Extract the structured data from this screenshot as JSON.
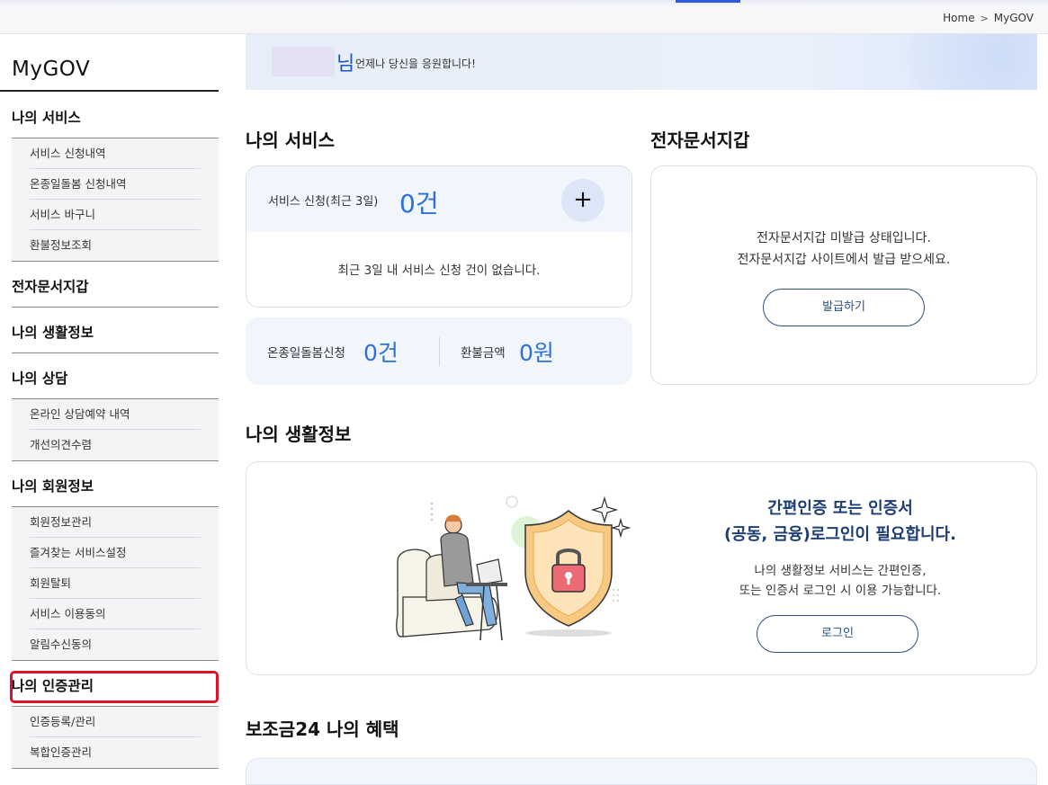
{
  "breadcrumb": {
    "home": "Home",
    "current": "MyGOV"
  },
  "sidebar": {
    "title": "MyGOV",
    "sections": [
      {
        "label": "나의 서비스",
        "items": [
          "서비스 신청내역",
          "온종일돌봄 신청내역",
          "서비스 바구니",
          "환불정보조회"
        ]
      },
      {
        "label": "전자문서지갑",
        "items": []
      },
      {
        "label": "나의 생활정보",
        "items": []
      },
      {
        "label": "나의 상담",
        "items": [
          "온라인 상담예약 내역",
          "개선의견수렴"
        ]
      },
      {
        "label": "나의 회원정보",
        "items": [
          "회원정보관리",
          "즐겨찾는 서비스설정",
          "회원탈퇴",
          "서비스 이용동의",
          "알림수신동의"
        ]
      },
      {
        "label": "나의 인증관리",
        "items": [
          "인증등록/관리",
          "복합인증관리"
        ]
      }
    ]
  },
  "banner": {
    "suffix": "님",
    "message": "언제나 당신을 응원합니다!"
  },
  "my_service": {
    "title": "나의 서비스",
    "apply_label": "서비스 신청(최근 3일)",
    "apply_count": "0건",
    "empty_text": "최근 3일 내 서비스 신청 건이 없습니다.",
    "care_label": "온종일돌봄신청",
    "care_value": "0건",
    "refund_label": "환불금액",
    "refund_value": "0원"
  },
  "wallet": {
    "title": "전자문서지갑",
    "line1": "전자문서지갑 미발급 상태입니다.",
    "line2": "전자문서지갑 사이트에서 발급 받으세요.",
    "button": "발급하기"
  },
  "life_info": {
    "title": "나의 생활정보",
    "headline1": "간편인증 또는 인증서",
    "headline2": "(공동, 금융)로그인이 필요합니다.",
    "desc1": "나의 생활정보 서비스는 간편인증,",
    "desc2": "또는 인증서 로그인 시 이용 가능합니다.",
    "button": "로그인"
  },
  "benefits": {
    "title": "보조금24 나의 혜택"
  },
  "colors": {
    "accent": "#2f6fd8",
    "highlight": "#e0102a",
    "navy": "#1c3d72"
  }
}
